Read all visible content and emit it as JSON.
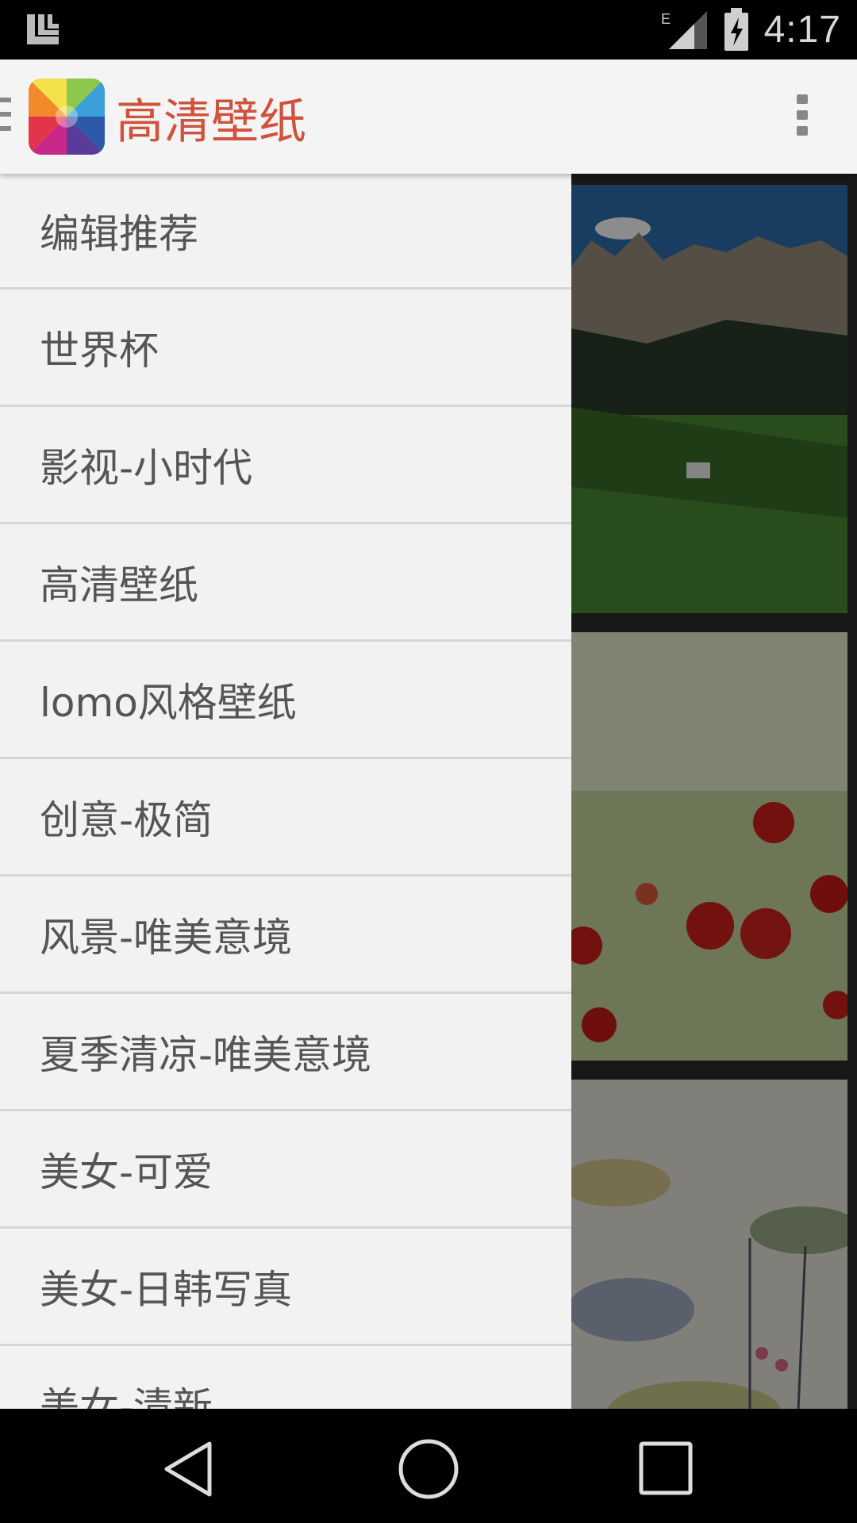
{
  "status_bar": {
    "time": "4:17",
    "network_type": "E",
    "icons": [
      "notification-icon",
      "signal-icon",
      "battery-charging-icon"
    ]
  },
  "app_bar": {
    "title": "高清壁纸",
    "icons": [
      "menu-icon",
      "app-logo",
      "overflow-menu-icon"
    ],
    "title_color": "#d0523c"
  },
  "drawer": {
    "items": [
      {
        "label": "编辑推荐"
      },
      {
        "label": "世界杯"
      },
      {
        "label": "影视-小时代"
      },
      {
        "label": "高清壁纸"
      },
      {
        "label": "lomo风格壁纸"
      },
      {
        "label": "创意-极简"
      },
      {
        "label": "风景-唯美意境"
      },
      {
        "label": "夏季清凉-唯美意境"
      },
      {
        "label": "美女-可爱"
      },
      {
        "label": "美女-日韩写真"
      },
      {
        "label": "美女-清新"
      }
    ]
  },
  "nav_bar": {
    "icons": [
      "back-icon",
      "home-icon",
      "recents-icon"
    ]
  }
}
